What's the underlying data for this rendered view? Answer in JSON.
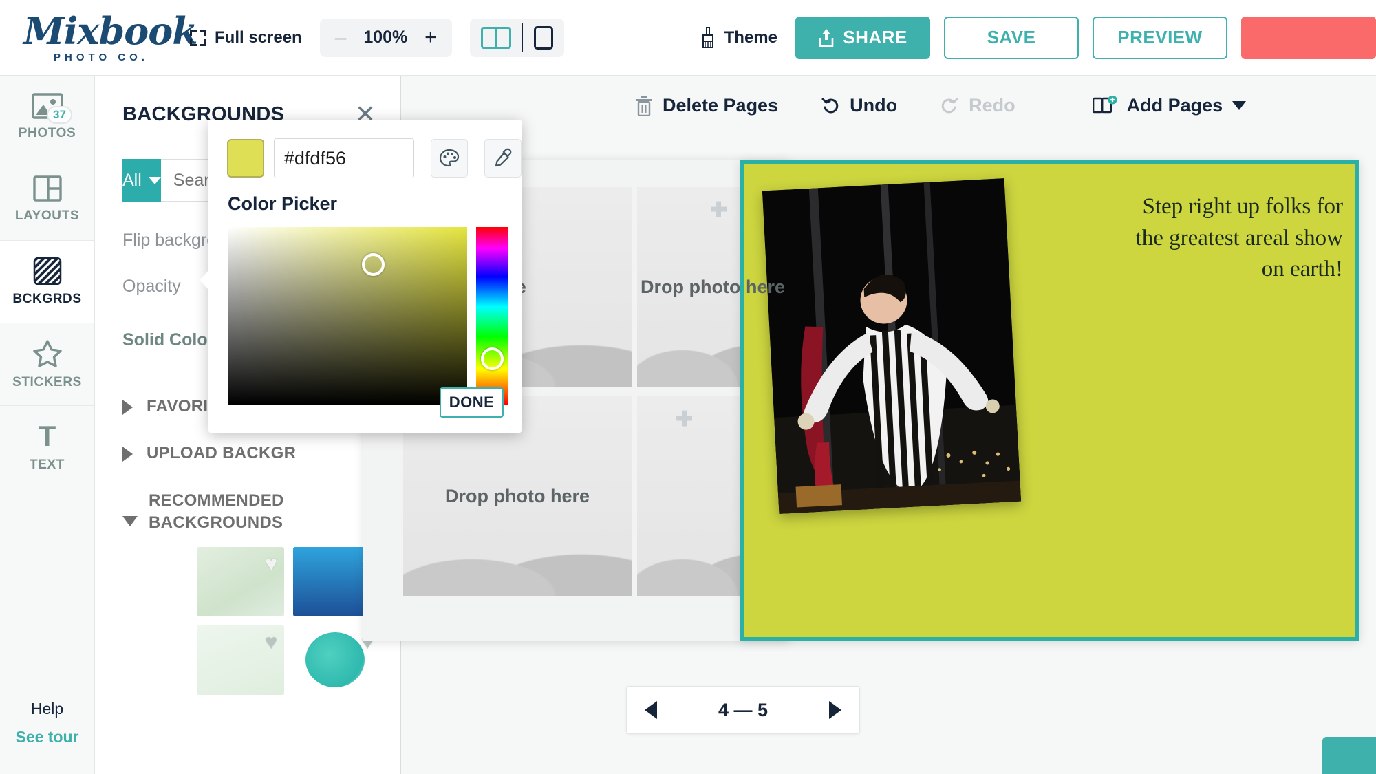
{
  "brand": {
    "name": "Mixbook",
    "tagline": "PHOTO CO."
  },
  "topbar": {
    "fullscreen_label": "Full screen",
    "zoom": {
      "minus": "–",
      "value": "100%",
      "plus": "+"
    },
    "theme_label": "Theme",
    "share_label": "SHARE",
    "save_label": "SAVE",
    "preview_label": "PREVIEW",
    "cart_label": ""
  },
  "rail": {
    "items": [
      {
        "label": "PHOTOS",
        "badge": "37"
      },
      {
        "label": "LAYOUTS",
        "badge": ""
      },
      {
        "label": "BCKGRDS",
        "badge": ""
      },
      {
        "label": "STICKERS",
        "badge": ""
      },
      {
        "label": "TEXT",
        "badge": ""
      }
    ],
    "help_label": "Help",
    "tour_label": "See tour"
  },
  "panel": {
    "title": "BACKGROUNDS",
    "close": "✕",
    "filter_label": "All",
    "search_placeholder": "Search b",
    "flip_label": "Flip background",
    "opacity_label": "Opacity",
    "solid_color_label": "Solid Color:",
    "solid_color_value": "#dfdf56",
    "sections": [
      {
        "label": "FAVORITE BACKG",
        "expanded": false
      },
      {
        "label": "UPLOAD BACKGR",
        "expanded": false
      },
      {
        "label": "RECOMMENDED BACKGROUNDS",
        "expanded": true
      }
    ]
  },
  "color_picker": {
    "hex_value": "#dfdf56",
    "confirm": "✔",
    "title": "Color Picker",
    "done_label": "DONE",
    "swatch_color": "#dfdf56",
    "palette_icon": "palette-icon",
    "eyedropper_icon": "eyedropper-icon"
  },
  "canvas": {
    "delete_pages": "Delete Pages",
    "undo": "Undo",
    "redo": "Redo",
    "add_pages": "Add Pages",
    "drop_placeholders": [
      "re",
      "Drop photo here",
      "Drop photo here"
    ],
    "page_text": "Step right up folks for the greatest areal show on earth!",
    "pagenav": {
      "label": "4 — 5",
      "prev": "◀",
      "next": "▶"
    }
  }
}
